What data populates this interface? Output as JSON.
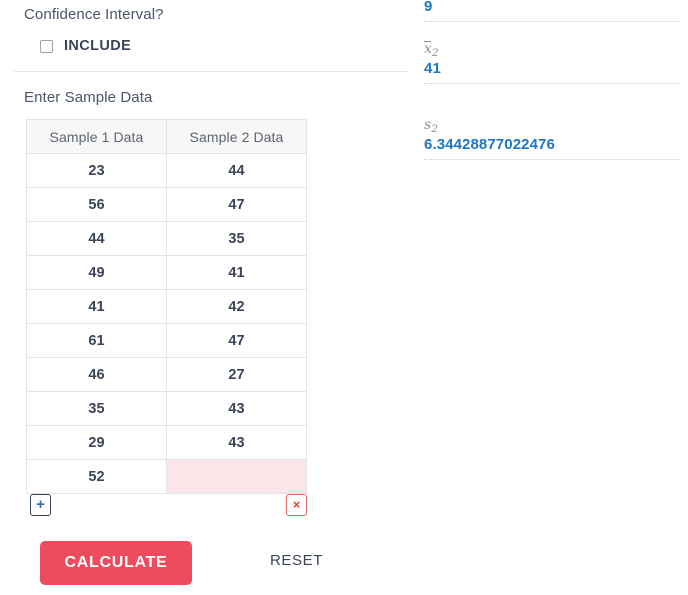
{
  "form": {
    "confidence_interval_label": "Confidence Interval?",
    "include_label": "INCLUDE",
    "include_checked": false,
    "enter_sample_data_label": "Enter Sample Data"
  },
  "table": {
    "columns": [
      "Sample 1 Data",
      "Sample 2 Data"
    ],
    "rows": [
      [
        "23",
        "44"
      ],
      [
        "56",
        "47"
      ],
      [
        "44",
        "35"
      ],
      [
        "49",
        "41"
      ],
      [
        "41",
        "42"
      ],
      [
        "61",
        "47"
      ],
      [
        "46",
        "27"
      ],
      [
        "35",
        "43"
      ],
      [
        "29",
        "43"
      ],
      [
        "52",
        ""
      ]
    ]
  },
  "row_controls": {
    "add_label": "+",
    "add_icon": "plus-icon",
    "remove_label": "×",
    "remove_icon": "close-icon"
  },
  "actions": {
    "calculate_label": "CALCULATE",
    "reset_label": "RESET"
  },
  "results": [
    {
      "label_html": "",
      "value": "9"
    },
    {
      "label_base": "x",
      "label_sub": "2",
      "label_overbar": true,
      "value": "41"
    },
    {
      "label_base": "s",
      "label_sub": "2",
      "label_overbar": false,
      "value": "6.34428877022476"
    }
  ],
  "colors": {
    "accent_red": "#ef4b5e",
    "value_blue": "#1b77c8",
    "error_cell_pink": "#fbe7e9",
    "text_dark": "#3b4559",
    "label_gray": "#8b9097",
    "border_gray": "#e2e4e7"
  }
}
